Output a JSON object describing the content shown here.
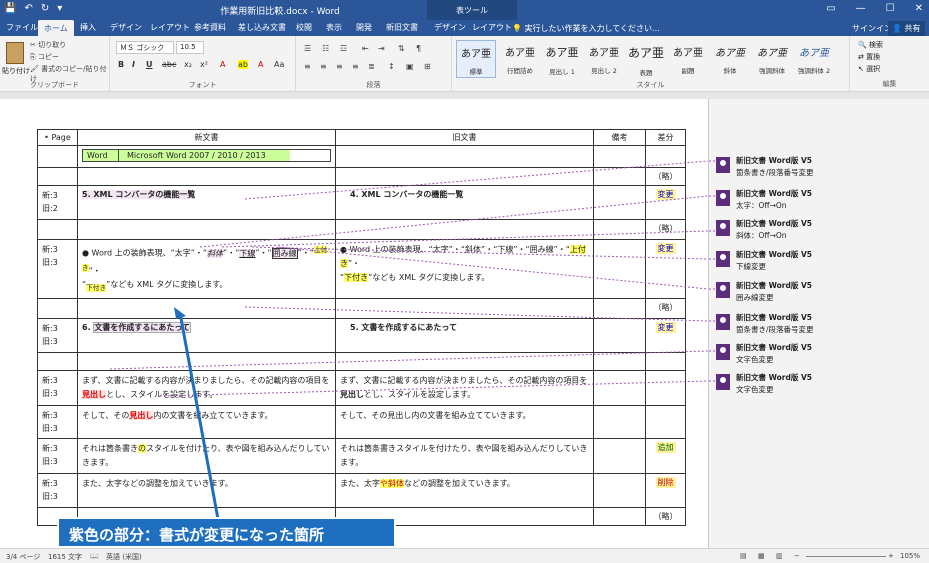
{
  "titlebar": {
    "title": "作業用新旧比較.docx - Word",
    "context_tab_group": "表ツール",
    "qa_save": "💾",
    "qa_undo": "↶",
    "qa_redo": "↻",
    "qa_more": "▾",
    "win_restore": "▭",
    "win_min": "—",
    "win_max": "☐",
    "win_close": "✕"
  },
  "tabs": {
    "file": "ファイル",
    "home": "ホーム",
    "insert": "挿入",
    "design": "デザイン",
    "layout": "レイアウト",
    "references": "参考資料",
    "mailings": "差し込み文書",
    "review": "校閲",
    "view": "表示",
    "developer": "開発",
    "newold": "新旧文書",
    "table_design": "デザイン",
    "table_layout": "レイアウト",
    "tell_me": "実行したい作業を入力してください...",
    "signin": "サインイン",
    "share": "共有"
  },
  "ribbon": {
    "clipboard": {
      "paste": "貼り付け",
      "cut": "切り取り",
      "copy": "コピー",
      "format_painter": "書式のコピー/貼り付け",
      "label": "クリップボード"
    },
    "font": {
      "name": "ＭＳ ゴシック",
      "size": "10.5",
      "label": "フォント",
      "b": "B",
      "i": "I",
      "u": "U",
      "abc": "abc",
      "sub": "x₂",
      "sup": "x²",
      "aa": "Aa"
    },
    "paragraph": {
      "label": "段落"
    },
    "styles": {
      "label": "スタイル",
      "items": [
        {
          "preview": "あア亜",
          "name": "標準"
        },
        {
          "preview": "あア亜",
          "name": "行間詰め"
        },
        {
          "preview": "あア亜",
          "name": "見出し 1"
        },
        {
          "preview": "あア亜",
          "name": "見出し 2"
        },
        {
          "preview": "あア亜",
          "name": "表題"
        },
        {
          "preview": "あア亜",
          "name": "副題"
        },
        {
          "preview": "あア亜",
          "name": "斜体"
        },
        {
          "preview": "あア亜",
          "name": "強調斜体"
        },
        {
          "preview": "あア亜",
          "name": "強調斜体 2"
        }
      ]
    },
    "editing": {
      "find": "検索",
      "replace": "置換",
      "select": "選択",
      "label": "編集"
    }
  },
  "table": {
    "headers": {
      "page": "Page",
      "new": "新文書",
      "old": "旧文書",
      "note": "備考",
      "diff": "差分"
    },
    "prop": {
      "app": "Word",
      "version": "Microsoft Word 2007 / 2010 / 2013"
    },
    "rows": {
      "r3_diff": "（略）",
      "r4_page": "新:3\n旧:2",
      "r4_new": "5.  XML コンバータの機能一覧",
      "r4_old": "4.  XML コンバータの機能一覧",
      "r4_diff": "変更",
      "r5_diff": "（略）",
      "r6_page": "新:3\n旧:3",
      "r6_new_a": "● Word 上の装飾表現、“太字”・“",
      "r6_new_b": "斜体",
      "r6_new_c": "”・“",
      "r6_new_d": "下線",
      "r6_new_e": "”・“",
      "r6_new_f": "囲み線",
      "r6_new_g": "”・“",
      "r6_new_h": "上付き",
      "r6_new_i": "”・",
      "r6_new_j": "“",
      "r6_new_k": "下付き",
      "r6_new_l": "”なども XML タグに変換します。",
      "r6_old_a": "● Word 上の装飾表現、“太字”・“斜体”・“下線”・“囲み線”・“",
      "r6_old_b": "上付き",
      "r6_old_c": "”・",
      "r6_old_d": "“",
      "r6_old_e": "下付き",
      "r6_old_f": "”なども XML タグに変換します。",
      "r6_diff": "変更",
      "r7_diff": "（略）",
      "r8_page": "新:3\n旧:3",
      "r8_new_num": "6.",
      "r8_new": "文書を作成するにあたって",
      "r8_old": "5.  文書を作成するにあたって",
      "r8_diff": "変更",
      "r10_page": "新:3\n旧:3",
      "r10_new_a": "まず、文書に記載する内容が決まりましたら、その記載内容の項目を",
      "r10_new_b": "見出し",
      "r10_new_c": "とし、スタイルを設定します。",
      "r10_old_a": "まず、文書に記載する内容が決まりましたら、その記載内容の項目を",
      "r10_old_b": "見出し",
      "r10_old_c": "とし、スタイルを設定します。",
      "r11_page": "新:3\n旧:3",
      "r11_new_a": "そして、その",
      "r11_new_b": "見出し",
      "r11_new_c": "内の文書を組み立てていきます。",
      "r11_old": "そして、その見出し内の文書を組み立てていきます。",
      "r12_page": "新:3\n旧:3",
      "r12_new_a": "それは箇条書き",
      "r12_new_b": "の",
      "r12_new_c": "スタイルを付けたり、表や図を組み込んだりしていきます。",
      "r12_old": "それは箇条書きスタイルを付けたり、表や図を組み込んだりしていきます。",
      "r12_diff": "追加",
      "r13_page": "新:3\n旧:3",
      "r13_new": "また、太字などの調整を加えていきます。",
      "r13_old_a": "また、太字",
      "r13_old_b": "や斜体",
      "r13_old_c": "などの調整を加えていきます。",
      "r13_diff": "削除",
      "r14_diff": "（略）"
    }
  },
  "comments": [
    {
      "who": "新旧文書 Word版 V5",
      "what": "箇条書き/段落番号変更"
    },
    {
      "who": "新旧文書 Word版 V5",
      "what": "太字：Off→On"
    },
    {
      "who": "新旧文書 Word版 V5",
      "what": "斜体：Off→On"
    },
    {
      "who": "新旧文書 Word版 V5",
      "what": "下線変更"
    },
    {
      "who": "新旧文書 Word版 V5",
      "what": "囲み線変更"
    },
    {
      "who": "新旧文書 Word版 V5",
      "what": "箇条書き/段落番号変更"
    },
    {
      "who": "新旧文書 Word版 V5",
      "what": "文字色変更"
    },
    {
      "who": "新旧文書 Word版 V5",
      "what": "文字色変更"
    }
  ],
  "callout": "紫色の部分：書式が変更になった箇所",
  "status": {
    "page": "3/4 ページ",
    "words": "1615 文字",
    "lang": "英語 (米国)",
    "zoom": "105%"
  },
  "colors": {
    "accent": "#2b579a",
    "callout": "#1f6fc0",
    "comment_avatar": "#5c2d7a"
  }
}
